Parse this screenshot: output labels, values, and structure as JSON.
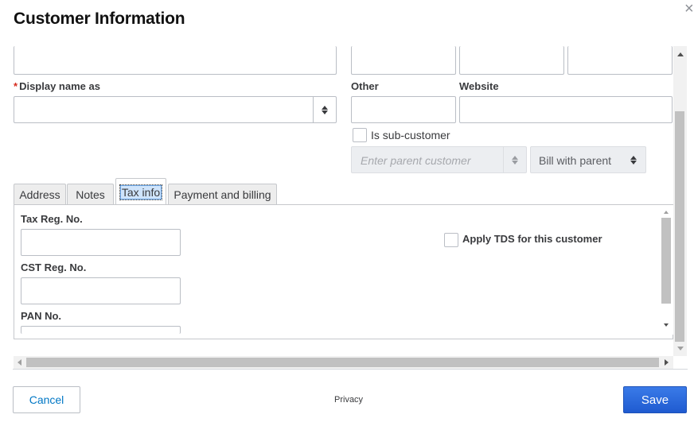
{
  "dialog": {
    "title": "Customer Information",
    "close_glyph": "×"
  },
  "form": {
    "display_name_label": "Display name as",
    "required_marker": "*",
    "other_label": "Other",
    "website_label": "Website",
    "sub_customer_label": "Is sub-customer",
    "parent_customer_placeholder": "Enter parent customer",
    "bill_with_label": "Bill with parent"
  },
  "tabs": [
    {
      "label": "Address",
      "active": false
    },
    {
      "label": "Notes",
      "active": false
    },
    {
      "label": "Tax info",
      "active": true
    },
    {
      "label": "Payment and billing",
      "active": false
    }
  ],
  "tax_info": {
    "tax_reg_label": "Tax Reg. No.",
    "cst_reg_label": "CST Reg. No.",
    "pan_label": "PAN No.",
    "apply_tds_label": "Apply TDS for this customer"
  },
  "footer": {
    "cancel_label": "Cancel",
    "privacy_label": "Privacy",
    "save_label": "Save"
  },
  "colors": {
    "accent": "#0077c5",
    "save_button": "#2d6ee8",
    "required": "#d52b1e"
  },
  "icons": [
    "close-icon",
    "updown-arrow-icon",
    "scroll-up-icon",
    "scroll-down-icon",
    "scroll-left-icon",
    "scroll-right-icon"
  ]
}
